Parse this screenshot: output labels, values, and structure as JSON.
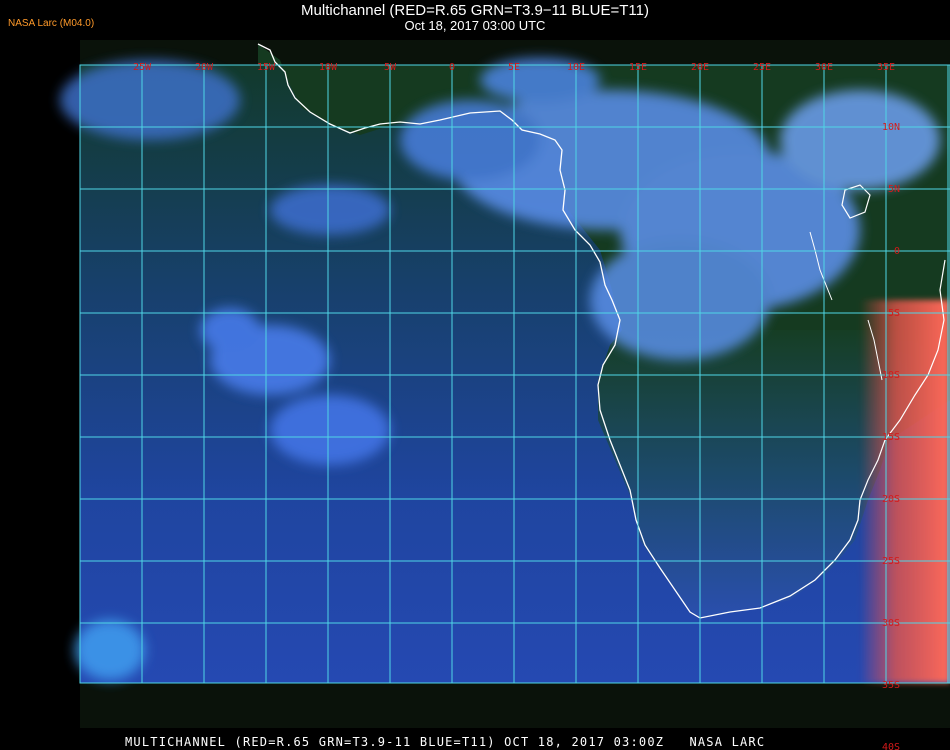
{
  "header": {
    "brand": "NASA Larc (M04.0)",
    "title": "Multichannel (RED=R.65 GRN=T3.9−11 BLUE=T11)",
    "subtitle": "Oct 18, 2017 03:00 UTC"
  },
  "footer": {
    "caption": "MULTICHANNEL (RED=R.65 GRN=T3.9-11 BLUE=T11) OCT 18, 2017 03:00Z   NASA LARC"
  },
  "grid": {
    "longitudes": [
      "25W",
      "20W",
      "15W",
      "10W",
      "5W",
      "0",
      "5E",
      "10E",
      "15E",
      "20E",
      "25E",
      "30E",
      "35E"
    ],
    "latitudes": [
      "10N",
      "5N",
      "0",
      "5S",
      "10S",
      "15S",
      "20S",
      "25S",
      "30S",
      "35S",
      "40S"
    ],
    "line_color": "#4fd6e6"
  },
  "colors": {
    "background": "#000000",
    "ocean": "#1e3f8a",
    "land": "#1b4a2a",
    "cloud": "#5a8ff0",
    "coast": "#ffffff",
    "label": "#d41a1a"
  }
}
